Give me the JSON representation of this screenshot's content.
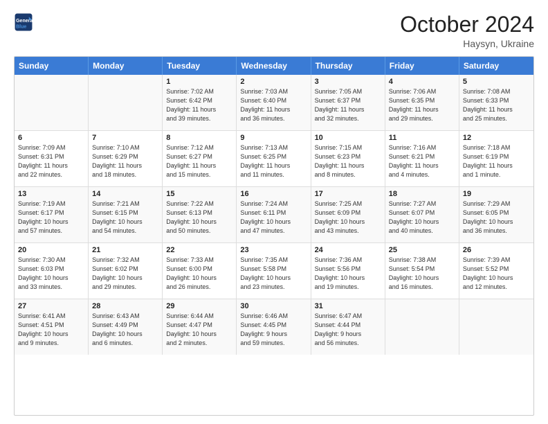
{
  "header": {
    "logo_line1": "General",
    "logo_line2": "Blue",
    "month": "October 2024",
    "location": "Haysyn, Ukraine"
  },
  "weekdays": [
    "Sunday",
    "Monday",
    "Tuesday",
    "Wednesday",
    "Thursday",
    "Friday",
    "Saturday"
  ],
  "rows": [
    [
      {
        "day": "",
        "empty": true
      },
      {
        "day": "",
        "empty": true
      },
      {
        "day": "1",
        "line1": "Sunrise: 7:02 AM",
        "line2": "Sunset: 6:42 PM",
        "line3": "Daylight: 11 hours",
        "line4": "and 39 minutes."
      },
      {
        "day": "2",
        "line1": "Sunrise: 7:03 AM",
        "line2": "Sunset: 6:40 PM",
        "line3": "Daylight: 11 hours",
        "line4": "and 36 minutes."
      },
      {
        "day": "3",
        "line1": "Sunrise: 7:05 AM",
        "line2": "Sunset: 6:37 PM",
        "line3": "Daylight: 11 hours",
        "line4": "and 32 minutes."
      },
      {
        "day": "4",
        "line1": "Sunrise: 7:06 AM",
        "line2": "Sunset: 6:35 PM",
        "line3": "Daylight: 11 hours",
        "line4": "and 29 minutes."
      },
      {
        "day": "5",
        "line1": "Sunrise: 7:08 AM",
        "line2": "Sunset: 6:33 PM",
        "line3": "Daylight: 11 hours",
        "line4": "and 25 minutes."
      }
    ],
    [
      {
        "day": "6",
        "line1": "Sunrise: 7:09 AM",
        "line2": "Sunset: 6:31 PM",
        "line3": "Daylight: 11 hours",
        "line4": "and 22 minutes."
      },
      {
        "day": "7",
        "line1": "Sunrise: 7:10 AM",
        "line2": "Sunset: 6:29 PM",
        "line3": "Daylight: 11 hours",
        "line4": "and 18 minutes."
      },
      {
        "day": "8",
        "line1": "Sunrise: 7:12 AM",
        "line2": "Sunset: 6:27 PM",
        "line3": "Daylight: 11 hours",
        "line4": "and 15 minutes."
      },
      {
        "day": "9",
        "line1": "Sunrise: 7:13 AM",
        "line2": "Sunset: 6:25 PM",
        "line3": "Daylight: 11 hours",
        "line4": "and 11 minutes."
      },
      {
        "day": "10",
        "line1": "Sunrise: 7:15 AM",
        "line2": "Sunset: 6:23 PM",
        "line3": "Daylight: 11 hours",
        "line4": "and 8 minutes."
      },
      {
        "day": "11",
        "line1": "Sunrise: 7:16 AM",
        "line2": "Sunset: 6:21 PM",
        "line3": "Daylight: 11 hours",
        "line4": "and 4 minutes."
      },
      {
        "day": "12",
        "line1": "Sunrise: 7:18 AM",
        "line2": "Sunset: 6:19 PM",
        "line3": "Daylight: 11 hours",
        "line4": "and 1 minute."
      }
    ],
    [
      {
        "day": "13",
        "line1": "Sunrise: 7:19 AM",
        "line2": "Sunset: 6:17 PM",
        "line3": "Daylight: 10 hours",
        "line4": "and 57 minutes."
      },
      {
        "day": "14",
        "line1": "Sunrise: 7:21 AM",
        "line2": "Sunset: 6:15 PM",
        "line3": "Daylight: 10 hours",
        "line4": "and 54 minutes."
      },
      {
        "day": "15",
        "line1": "Sunrise: 7:22 AM",
        "line2": "Sunset: 6:13 PM",
        "line3": "Daylight: 10 hours",
        "line4": "and 50 minutes."
      },
      {
        "day": "16",
        "line1": "Sunrise: 7:24 AM",
        "line2": "Sunset: 6:11 PM",
        "line3": "Daylight: 10 hours",
        "line4": "and 47 minutes."
      },
      {
        "day": "17",
        "line1": "Sunrise: 7:25 AM",
        "line2": "Sunset: 6:09 PM",
        "line3": "Daylight: 10 hours",
        "line4": "and 43 minutes."
      },
      {
        "day": "18",
        "line1": "Sunrise: 7:27 AM",
        "line2": "Sunset: 6:07 PM",
        "line3": "Daylight: 10 hours",
        "line4": "and 40 minutes."
      },
      {
        "day": "19",
        "line1": "Sunrise: 7:29 AM",
        "line2": "Sunset: 6:05 PM",
        "line3": "Daylight: 10 hours",
        "line4": "and 36 minutes."
      }
    ],
    [
      {
        "day": "20",
        "line1": "Sunrise: 7:30 AM",
        "line2": "Sunset: 6:03 PM",
        "line3": "Daylight: 10 hours",
        "line4": "and 33 minutes."
      },
      {
        "day": "21",
        "line1": "Sunrise: 7:32 AM",
        "line2": "Sunset: 6:02 PM",
        "line3": "Daylight: 10 hours",
        "line4": "and 29 minutes."
      },
      {
        "day": "22",
        "line1": "Sunrise: 7:33 AM",
        "line2": "Sunset: 6:00 PM",
        "line3": "Daylight: 10 hours",
        "line4": "and 26 minutes."
      },
      {
        "day": "23",
        "line1": "Sunrise: 7:35 AM",
        "line2": "Sunset: 5:58 PM",
        "line3": "Daylight: 10 hours",
        "line4": "and 23 minutes."
      },
      {
        "day": "24",
        "line1": "Sunrise: 7:36 AM",
        "line2": "Sunset: 5:56 PM",
        "line3": "Daylight: 10 hours",
        "line4": "and 19 minutes."
      },
      {
        "day": "25",
        "line1": "Sunrise: 7:38 AM",
        "line2": "Sunset: 5:54 PM",
        "line3": "Daylight: 10 hours",
        "line4": "and 16 minutes."
      },
      {
        "day": "26",
        "line1": "Sunrise: 7:39 AM",
        "line2": "Sunset: 5:52 PM",
        "line3": "Daylight: 10 hours",
        "line4": "and 12 minutes."
      }
    ],
    [
      {
        "day": "27",
        "line1": "Sunrise: 6:41 AM",
        "line2": "Sunset: 4:51 PM",
        "line3": "Daylight: 10 hours",
        "line4": "and 9 minutes."
      },
      {
        "day": "28",
        "line1": "Sunrise: 6:43 AM",
        "line2": "Sunset: 4:49 PM",
        "line3": "Daylight: 10 hours",
        "line4": "and 6 minutes."
      },
      {
        "day": "29",
        "line1": "Sunrise: 6:44 AM",
        "line2": "Sunset: 4:47 PM",
        "line3": "Daylight: 10 hours",
        "line4": "and 2 minutes."
      },
      {
        "day": "30",
        "line1": "Sunrise: 6:46 AM",
        "line2": "Sunset: 4:45 PM",
        "line3": "Daylight: 9 hours",
        "line4": "and 59 minutes."
      },
      {
        "day": "31",
        "line1": "Sunrise: 6:47 AM",
        "line2": "Sunset: 4:44 PM",
        "line3": "Daylight: 9 hours",
        "line4": "and 56 minutes."
      },
      {
        "day": "",
        "empty": true
      },
      {
        "day": "",
        "empty": true
      }
    ]
  ]
}
